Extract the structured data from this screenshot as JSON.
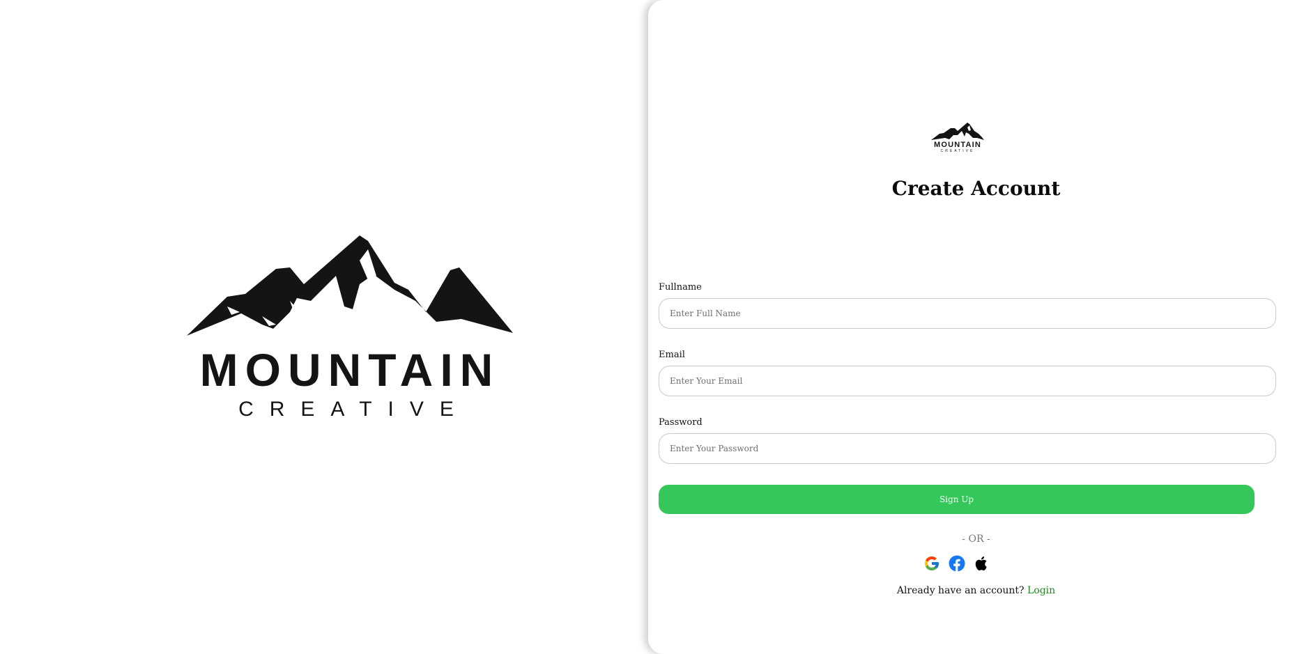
{
  "brand": {
    "logo_word": "MOUNTAIN",
    "logo_subword": "CREATIVE"
  },
  "form": {
    "title": "Create Account",
    "fullname": {
      "label": "Fullname",
      "placeholder": "Enter Full Name",
      "value": ""
    },
    "email": {
      "label": "Email",
      "placeholder": "Enter Your Email",
      "value": ""
    },
    "password": {
      "label": "Password",
      "placeholder": "Enter Your Password",
      "value": ""
    },
    "submit_label": "Sign Up",
    "divider_text": "- OR -",
    "social": [
      {
        "name": "google-icon"
      },
      {
        "name": "facebook-icon"
      },
      {
        "name": "apple-icon"
      }
    ],
    "login_prompt": "Already have an account?",
    "login_link": "Login"
  },
  "colors": {
    "accent": "#36c75a",
    "link": "#1d8a1d",
    "logo": "#141414",
    "facebook": "#1877f2"
  }
}
